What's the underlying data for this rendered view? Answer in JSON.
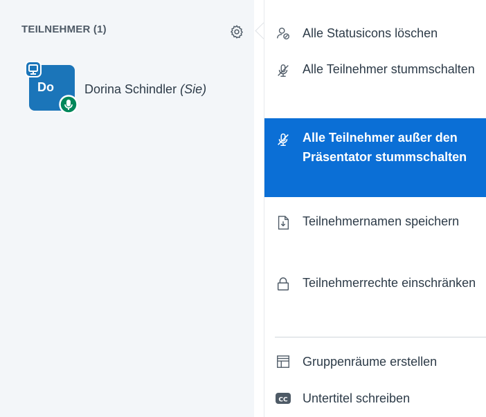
{
  "participants_panel": {
    "title": "TEILNEHMER (1)",
    "users": [
      {
        "initials": "Do",
        "name": "Dorina Schindler",
        "self_tag": "(Sie)"
      }
    ]
  },
  "options_menu": {
    "items": [
      {
        "label": "Alle Statusicons löschen",
        "icon": "clear-status-icon",
        "active": false
      },
      {
        "label": "Alle Teilnehmer stummschalten",
        "icon": "mute-icon",
        "active": false
      },
      {
        "label": "Alle Teilnehmer außer den Präsentator stummschalten",
        "icon": "mute-icon",
        "active": true
      },
      {
        "label": "Teilnehmernamen speichern",
        "icon": "download-file-icon",
        "active": false
      },
      {
        "label": "Teilnehmerrechte einschränken",
        "icon": "lock-icon",
        "active": false
      },
      {
        "label": "Gruppenräume erstellen",
        "icon": "breakout-rooms-icon",
        "active": false
      },
      {
        "label": "Untertitel schreiben",
        "icon": "closed-caption-icon",
        "active": false
      }
    ]
  },
  "colors": {
    "panel_bg": "#f3f6f9",
    "accent": "#0b6fd6",
    "avatar": "#1b75b9",
    "mic_badge": "#00875a",
    "text": "#2d3b48"
  }
}
